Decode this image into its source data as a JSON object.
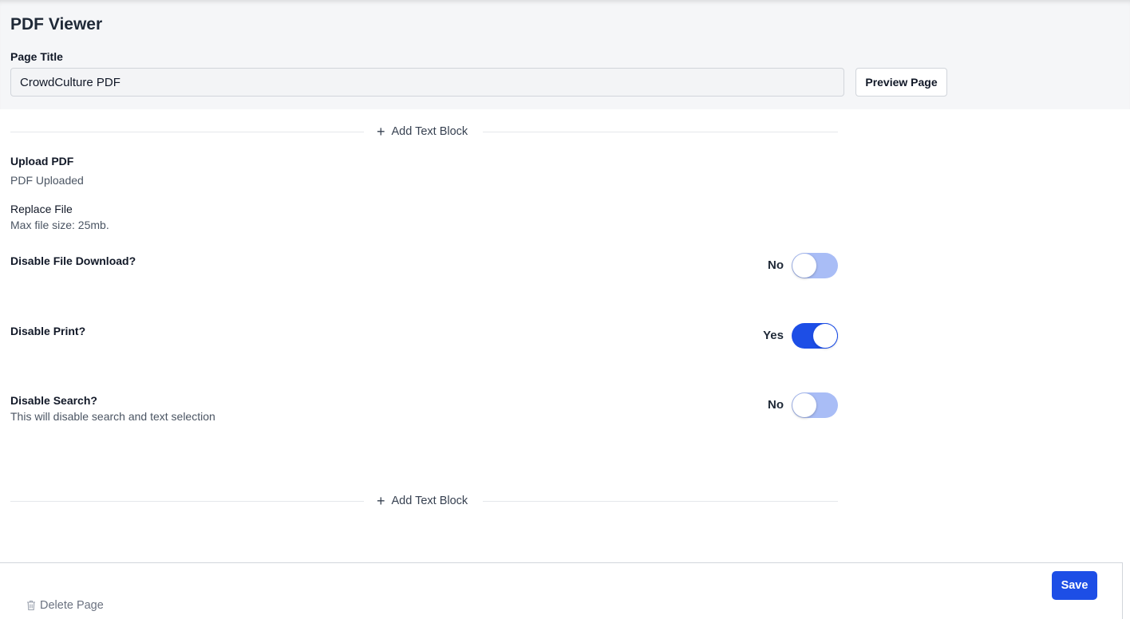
{
  "header": {
    "title": "PDF Viewer",
    "page_title_label": "Page Title",
    "page_title_value": "CrowdCulture PDF",
    "preview_label": "Preview Page"
  },
  "add_text_block_label": "Add Text Block",
  "upload": {
    "label": "Upload PDF",
    "status": "PDF Uploaded",
    "replace_label": "Replace File",
    "max_size": "Max file size: 25mb."
  },
  "settings": [
    {
      "label": "Disable File Download?",
      "description": "",
      "value_text": "No",
      "enabled": false
    },
    {
      "label": "Disable Print?",
      "description": "",
      "value_text": "Yes",
      "enabled": true
    },
    {
      "label": "Disable Search?",
      "description": "This will disable search and text selection",
      "value_text": "No",
      "enabled": false
    }
  ],
  "footer": {
    "save_label": "Save",
    "delete_label": "Delete Page"
  },
  "icons": {
    "add": "plus-icon",
    "delete": "trash-icon"
  },
  "colors": {
    "accent": "#1d4ee6",
    "toggle_off": "#a9bdf6",
    "header_bg": "#f5f6f8"
  }
}
